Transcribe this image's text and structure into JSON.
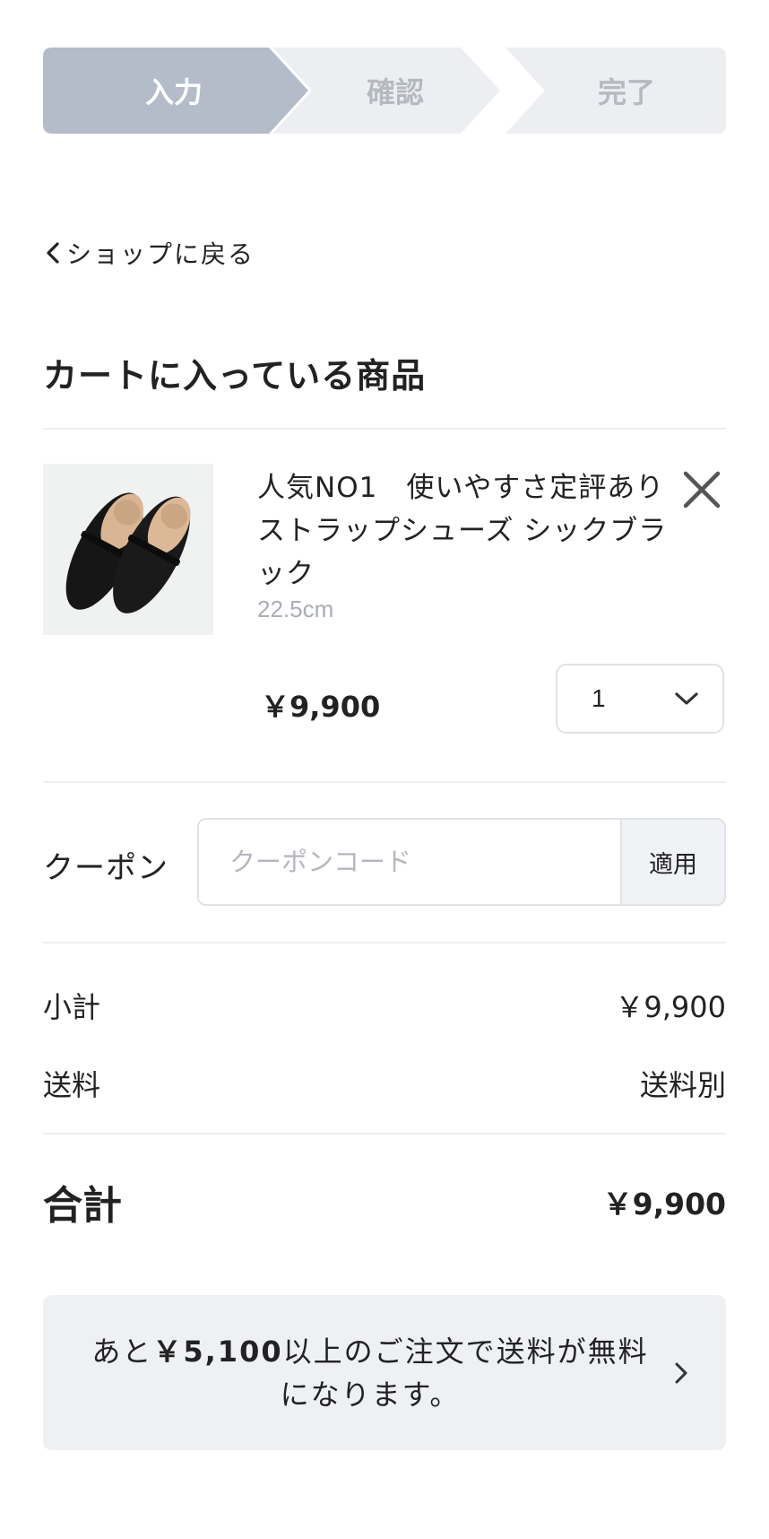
{
  "steps": [
    {
      "label": "入力",
      "state": "active"
    },
    {
      "label": "確認",
      "state": "inactive"
    },
    {
      "label": "完了",
      "state": "inactive"
    }
  ],
  "back_link": "ショップに戻る",
  "cart_title": "カートに入っている商品",
  "item": {
    "name": "人気NO1　使いやすさ定評あり　ストラップシューズ シックブラック",
    "variant": "22.5cm",
    "price": "￥9,900",
    "quantity": "1"
  },
  "coupon": {
    "label": "クーポン",
    "placeholder": "クーポンコード",
    "apply_label": "適用"
  },
  "summary": {
    "subtotal_label": "小計",
    "subtotal_value": "￥9,900",
    "shipping_label": "送料",
    "shipping_value": "送料別",
    "total_label": "合計",
    "total_value": "￥9,900"
  },
  "free_shipping": {
    "prefix": "あと",
    "amount": "￥5,100",
    "suffix": "以上のご注文で送料が無料",
    "line2": "になります。"
  },
  "colors": {
    "step_active": "#b3bcc8",
    "step_inactive": "#eceef1",
    "step_inactive_text": "#b5bac1",
    "notice_bg": "#eef0f4",
    "divider": "#eceef1"
  }
}
